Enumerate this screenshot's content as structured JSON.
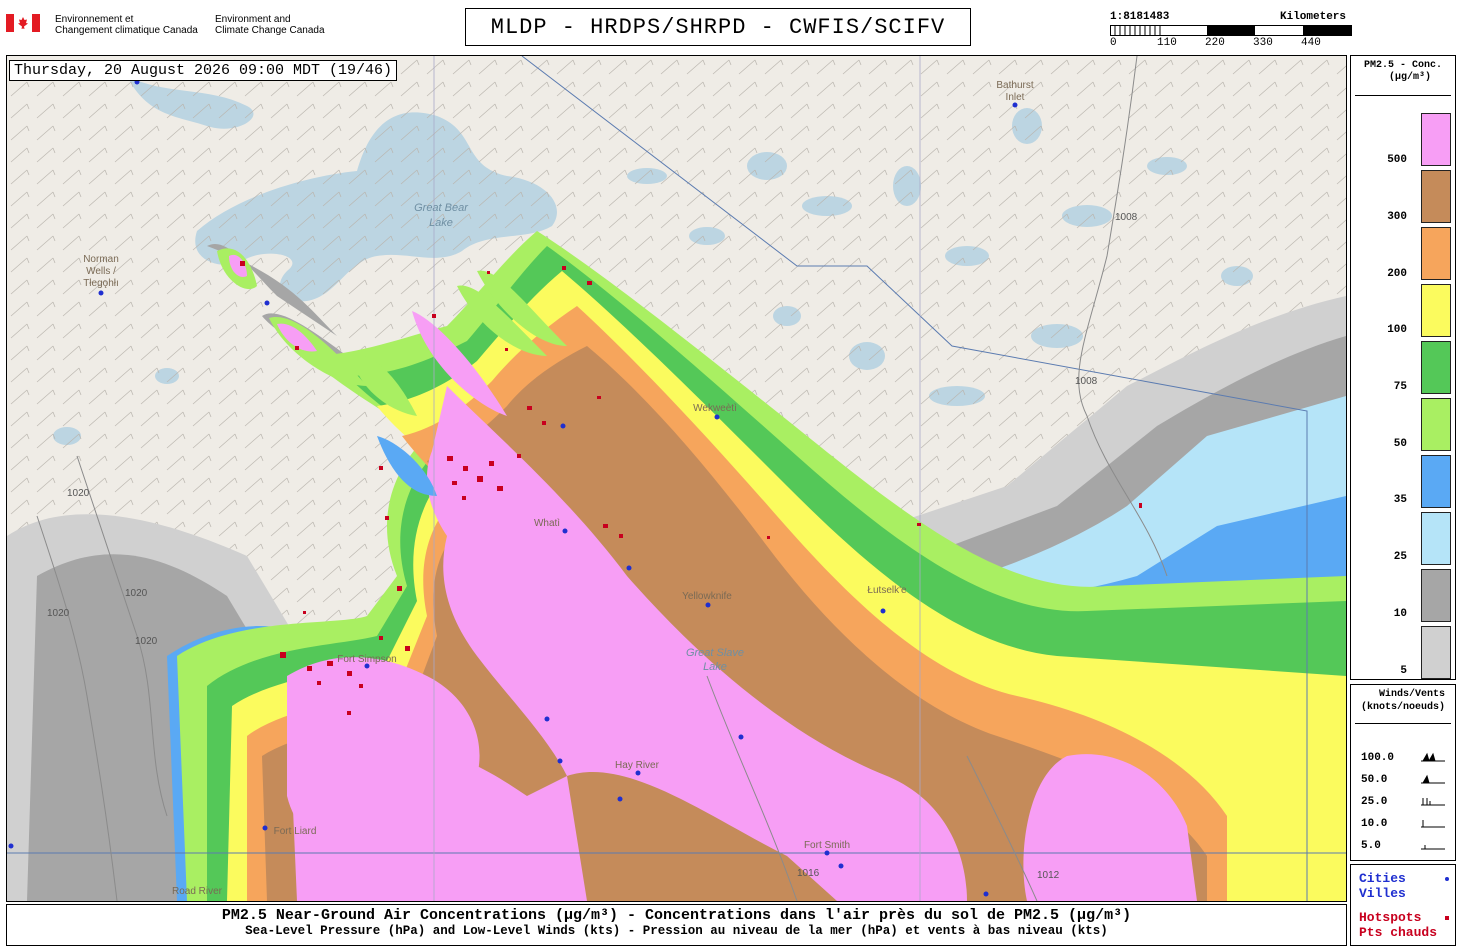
{
  "header": {
    "agency_fr_line1": "Environnement et",
    "agency_fr_line2": "Changement climatique Canada",
    "agency_en_line1": "Environment and",
    "agency_en_line2": "Climate Change Canada",
    "title": "MLDP - HRDPS/SHRPD - CWFIS/SCIFV",
    "scale_ratio": "1:8181483",
    "scale_unit": "Kilometers",
    "scale_ticks": [
      "0",
      "110",
      "220",
      "330",
      "440"
    ]
  },
  "map": {
    "datetime": "Thursday, 20 August 2026 09:00 MDT (19/46)",
    "places": {
      "norman_wells_1": "Norman",
      "norman_wells_2": "Wells /",
      "norman_wells_3": "Tłegǫhłı",
      "bathurst_1": "Bathurst",
      "bathurst_2": "Inlet",
      "wekweeti": "Wekweètì",
      "whati": "Whatì",
      "yellowknife": "Yellowknife",
      "lutselke": "Łutselk'e",
      "hay_river": "Hay River",
      "fort_smith": "Fort Smith",
      "road_river": "Road River",
      "fort_liard": "Fort Liard",
      "fort_simpson": "Fort Simpson"
    },
    "lakes": {
      "great_bear_1": "Great Bear",
      "great_bear_2": "Lake",
      "great_slave_1": "Great Slave",
      "great_slave_2": "Lake"
    },
    "isobars": [
      "1008",
      "1008",
      "1020",
      "1020",
      "1020",
      "1020",
      "1016",
      "1012"
    ]
  },
  "legend": {
    "conc_title_1": "PM2.5 - Conc.",
    "conc_title_2": "(µg/m³)",
    "levels": [
      {
        "label": "500",
        "color": "#f79ef5"
      },
      {
        "label": "300",
        "color": "#c58b5a"
      },
      {
        "label": "200",
        "color": "#f6a55c"
      },
      {
        "label": "100",
        "color": "#fbfb5e"
      },
      {
        "label": "75",
        "color": "#54c858"
      },
      {
        "label": "50",
        "color": "#a9ef62"
      },
      {
        "label": "35",
        "color": "#5aa9f4"
      },
      {
        "label": "25",
        "color": "#b5e4f8"
      },
      {
        "label": "10",
        "color": "#a6a6a6"
      },
      {
        "label": "5",
        "color": "#d0d0d0"
      }
    ],
    "wind_title_1": "Winds/Vents",
    "wind_title_2": "(knots/noeuds)",
    "wind_rows": [
      "100.0",
      "50.0",
      "25.0",
      "10.0",
      "5.0"
    ],
    "cities_en": "Cities",
    "cities_fr": "Villes",
    "hotspots_en": "Hotspots",
    "hotspots_fr": "Pts chauds"
  },
  "footer": {
    "line1": "PM2.5 Near-Ground Air Concentrations (µg/m³) - Concentrations dans l'air près du sol de PM2.5 (µg/m³)",
    "line2": "Sea-Level Pressure (hPa) and Low-Level Winds (kts) - Pression au niveau de la mer (hPa) et vents à bas niveau (kts)"
  },
  "colors": {
    "land": "#efece6",
    "water": "#bcd5e2",
    "city_dot": "#1f2fd0",
    "hotspot": "#c8001e"
  }
}
